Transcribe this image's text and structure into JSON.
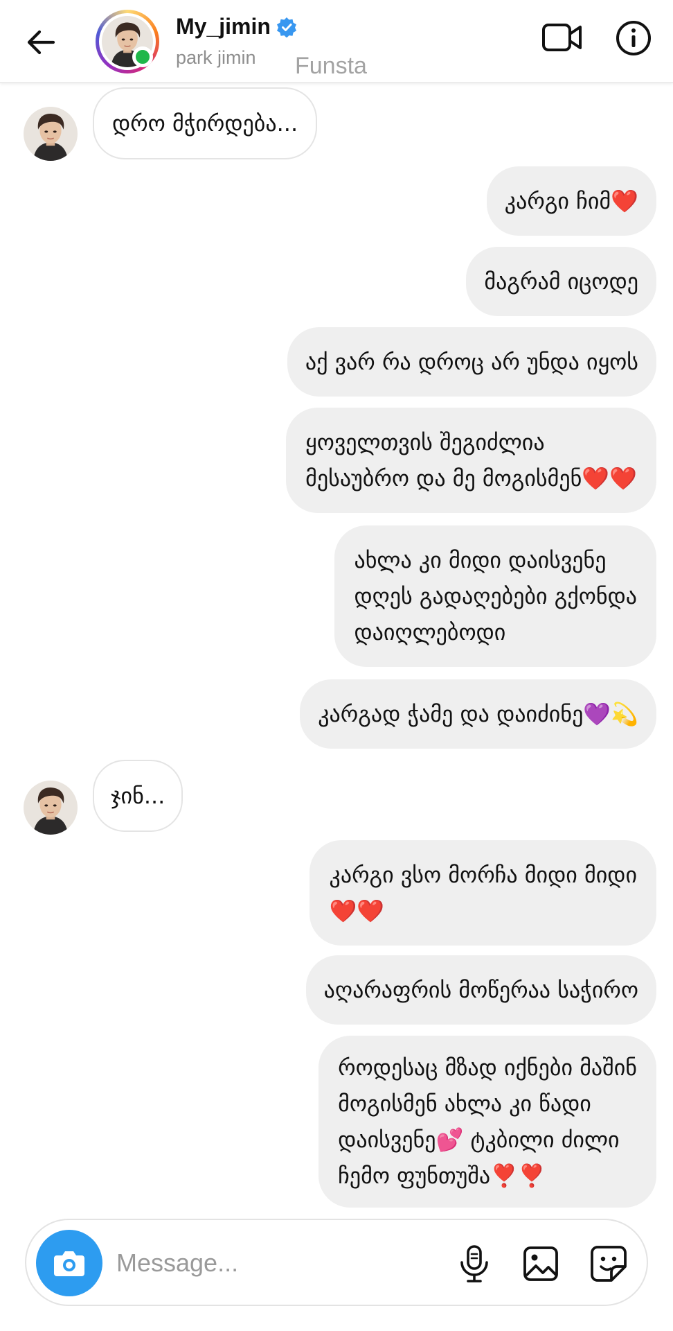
{
  "header": {
    "username": "My_jimin",
    "full_name": "park jimin",
    "watermark": "Funsta",
    "verified": true,
    "online_status_color": "#1fb74a",
    "icons": [
      "back-arrow-icon",
      "verified-badge-icon",
      "video-call-icon",
      "info-icon"
    ]
  },
  "messages": [
    {
      "dir": "in",
      "text": "დრო მჭირდება..."
    },
    {
      "dir": "out",
      "text": "კარგი ჩიმ❤️"
    },
    {
      "dir": "out",
      "text": "მაგრამ იცოდე"
    },
    {
      "dir": "out",
      "text": "აქ ვარ რა დროც არ უნდა იყოს"
    },
    {
      "dir": "out",
      "text": "ყოველთვის შეგიძლია\nმესაუბრო და მე მოგისმენ❤️❤️"
    },
    {
      "dir": "out",
      "text": "ახლა კი მიდი დაისვენე\nდღეს გადაღებები გქონდა\nდაიღლებოდი"
    },
    {
      "dir": "out",
      "text": "კარგად  ჭამე და დაიძინე💜💫"
    },
    {
      "dir": "in",
      "text": "ჯინ..."
    },
    {
      "dir": "out",
      "text": "კარგი ვსო მორჩა მიდი მიდი\n❤️❤️"
    },
    {
      "dir": "out",
      "text": "აღარაფრის მოწერაა საჭირო"
    },
    {
      "dir": "out",
      "text": "როდესაც მზად იქნები მაშინ\nმოგისმენ ახლა კი წადი\nდაისვენე💕 ტკბილი ძილი\nჩემო ფუნთუშა❣️❣️"
    }
  ],
  "composer": {
    "placeholder": "Message...",
    "icons": [
      "camera-icon",
      "microphone-icon",
      "gallery-icon",
      "sticker-icon"
    ],
    "accent_color": "#2d9cf0"
  },
  "colors": {
    "outgoing_bubble": "#efefef",
    "incoming_bubble_border": "#e4e4e4",
    "secondary_text": "#8e8e8e"
  }
}
